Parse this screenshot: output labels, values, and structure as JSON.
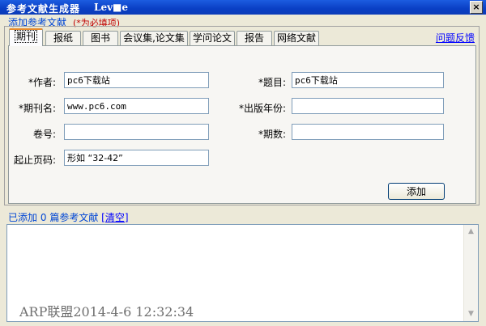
{
  "window": {
    "title": "参考文献生成器",
    "title_suffix": "Lev■e",
    "close_label": "×"
  },
  "group": {
    "caption": "添加参考文献",
    "required_note": "(*为必填项)"
  },
  "tabs": [
    {
      "label": "期刊",
      "active": true
    },
    {
      "label": "报纸",
      "active": false
    },
    {
      "label": "图书",
      "active": false
    },
    {
      "label": "会议集,论文集",
      "active": false
    },
    {
      "label": "学问论文",
      "active": false
    },
    {
      "label": "报告",
      "active": false
    },
    {
      "label": "网络文献",
      "active": false
    }
  ],
  "help_link": "问题反馈",
  "form": {
    "author": {
      "label": "*作者:",
      "value": "pc6下载站"
    },
    "title": {
      "label": "*题目:",
      "value": "pc6下载站"
    },
    "journal": {
      "label": "*期刊名:",
      "value": "www.pc6.com"
    },
    "year": {
      "label": "*出版年份:",
      "value": ""
    },
    "volume": {
      "label": "卷号:",
      "value": ""
    },
    "issue": {
      "label": "*期数:",
      "value": ""
    },
    "pages": {
      "label": "起止页码:",
      "value": "形如 “32-42”"
    }
  },
  "add_button": "添加",
  "status": {
    "prefix": "已添加",
    "count": "0",
    "suffix": "篇参考文献",
    "clear_link": "[清空]"
  },
  "output": {
    "content": "",
    "watermark": "ARP联盟2014-4-6 12:32:34"
  },
  "colors": {
    "titlebar": "#0a3fc4",
    "window_bg": "#ece9d8",
    "caption_blue": "#0046d5",
    "required_red": "#c00000",
    "active_tab_accent": "#e68b2c"
  }
}
